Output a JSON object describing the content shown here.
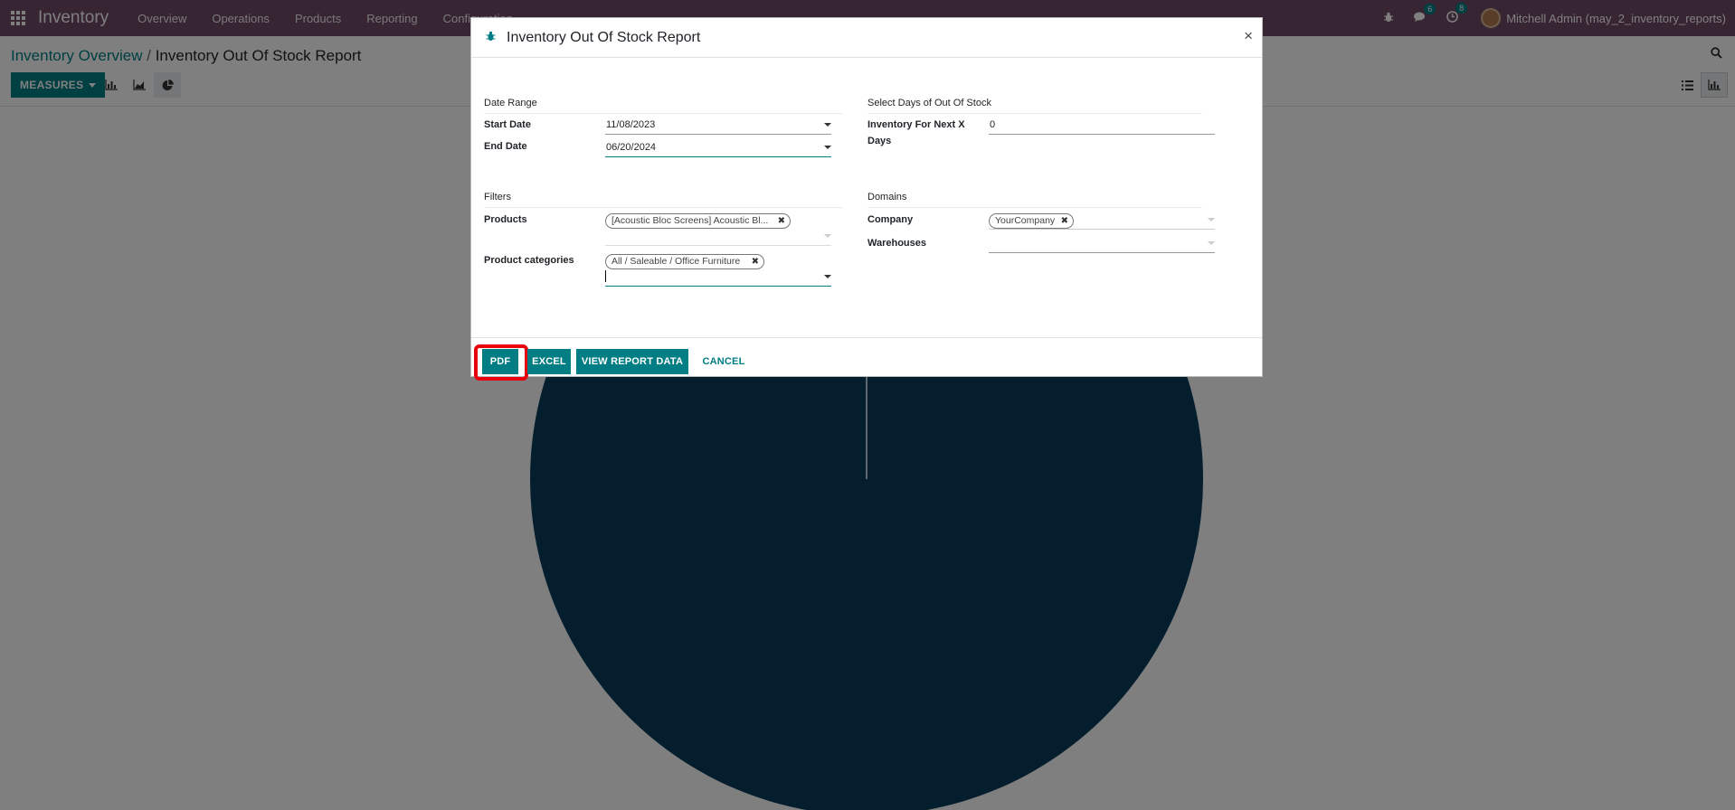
{
  "navbar": {
    "app_name": "Inventory",
    "menu": [
      "Overview",
      "Operations",
      "Products",
      "Reporting",
      "Configuration"
    ],
    "messages_count": "6",
    "activities_count": "8",
    "user": "Mitchell Admin (may_2_inventory_reports)"
  },
  "control_panel": {
    "breadcrumb_parent": "Inventory Overview",
    "breadcrumb_separator": "/",
    "breadcrumb_current": "Inventory Out Of Stock Report",
    "measures_label": "MEASURES"
  },
  "chart": {
    "fill_color": "#0b3c5d"
  },
  "modal": {
    "title": "Inventory Out Of Stock Report",
    "close_label": "×",
    "date_range": {
      "group_title": "Date Range",
      "start_label": "Start Date",
      "start_value": "11/08/2023",
      "end_label": "End Date",
      "end_value": "06/20/2024"
    },
    "days_group": {
      "group_title": "Select Days of Out Of Stock",
      "label": "Inventory For Next X Days",
      "value": "0"
    },
    "filters": {
      "group_title": "Filters",
      "products_label": "Products",
      "products_tag": "[Acoustic Bloc Screens] Acoustic Bl...",
      "categories_label": "Product categories",
      "categories_tag": "All / Saleable / Office Furniture"
    },
    "domains": {
      "group_title": "Domains",
      "company_label": "Company",
      "company_tag": "YourCompany",
      "warehouses_label": "Warehouses"
    },
    "footer": {
      "pdf": "PDF",
      "excel": "EXCEL",
      "view_data": "VIEW REPORT DATA",
      "cancel": "CANCEL"
    }
  },
  "colors": {
    "brand": "#714B67",
    "primary": "#017e84",
    "highlight": "#e8000b"
  }
}
